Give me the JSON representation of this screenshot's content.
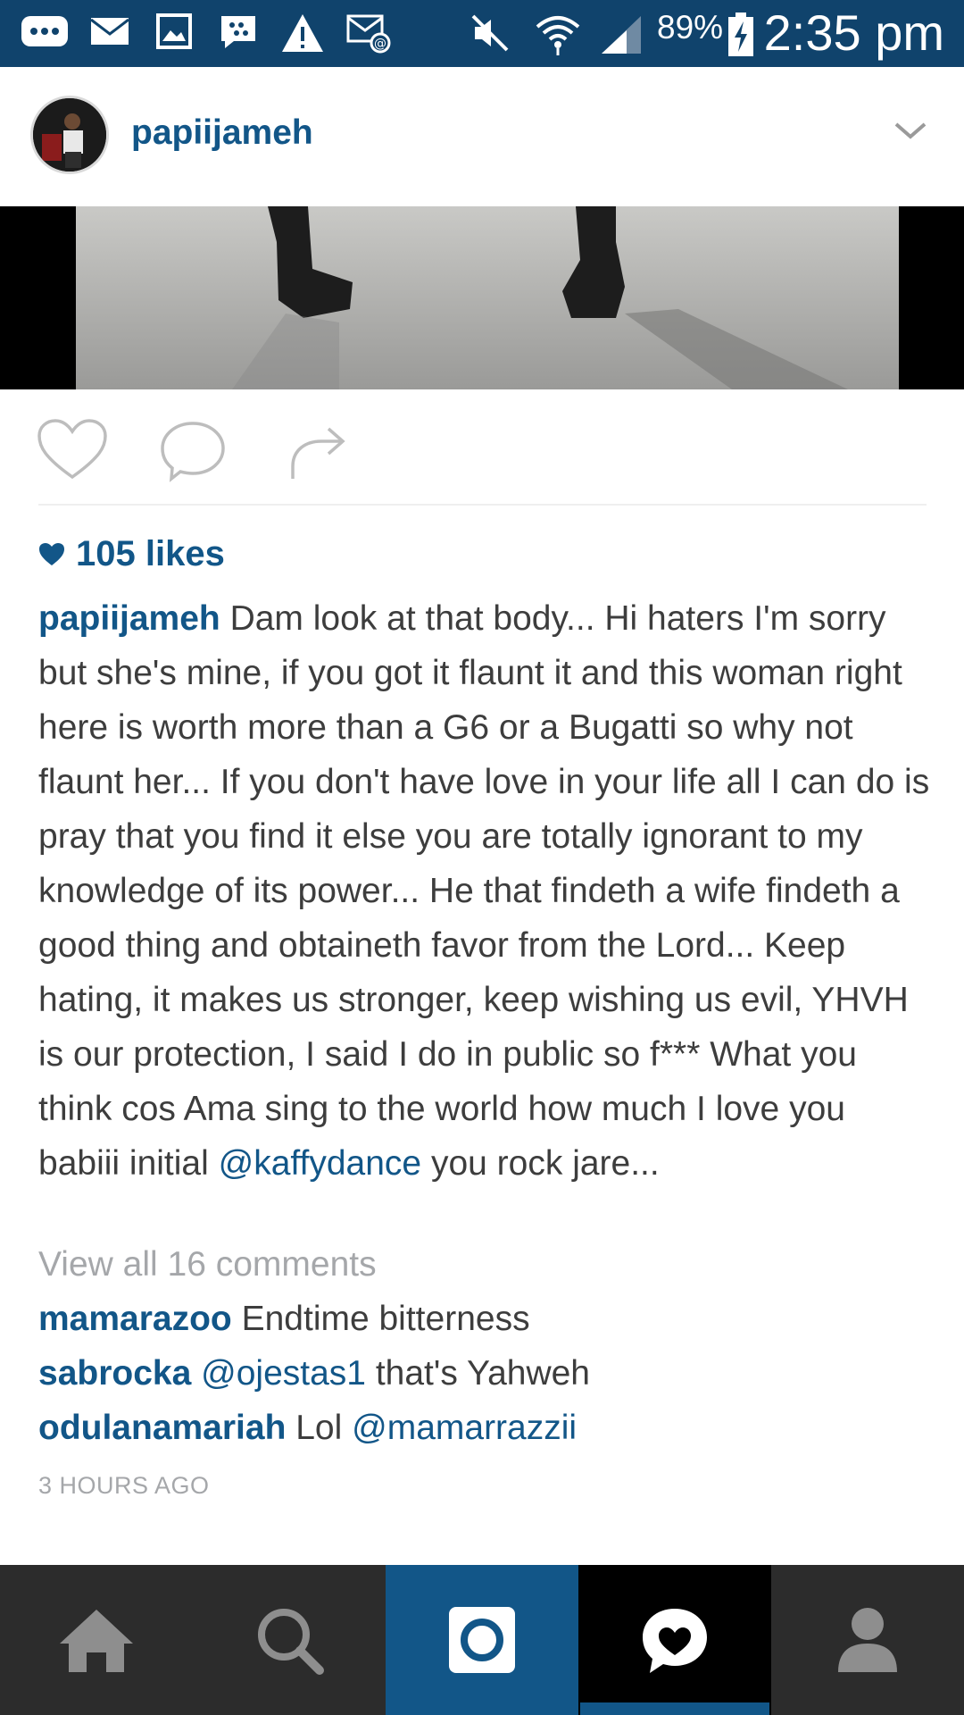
{
  "status_bar": {
    "battery": "89%",
    "time": "2:35 pm",
    "icons": [
      "messages-icon",
      "mail-icon",
      "gallery-icon",
      "bbm-icon",
      "warning-icon",
      "email-at-icon",
      "mute-icon",
      "wifi-icon",
      "signal-icon",
      "battery-charging-icon"
    ]
  },
  "post": {
    "username": "papiijameh",
    "likes": "105 likes",
    "caption_user": "papiijameh",
    "caption_text": " Dam look at that body... Hi haters I'm sorry but she's mine, if you got it flaunt it and this woman right here is worth more than a G6 or a Bugatti so why not flaunt her... If you don't have love in your life all I can do is pray that you find it else you are totally ignorant to my knowledge of its power... He that findeth a wife findeth a good thing and obtaineth favor from the Lord... Keep hating, it makes us stronger, keep wishing us evil, YHVH is our protection, I said I do in public so f*** What you think cos Ama sing to the world how much I love you babiii initial ",
    "caption_mention": "@kaffydance",
    "caption_end": " you rock jare...",
    "view_all": "View all 16 comments",
    "comments": [
      {
        "user": "mamarazoo",
        "pre": " Endtime bitterness",
        "mention": "",
        "post": ""
      },
      {
        "user": "sabrocka",
        "pre": " ",
        "mention": "@ojestas1",
        "post": " that's Yahweh"
      },
      {
        "user": "odulanamariah",
        "pre": " Lol ",
        "mention": "@mamarrazzii",
        "post": ""
      }
    ],
    "time_ago": "3 HOURS AGO"
  },
  "tabs": [
    "home-icon",
    "search-icon",
    "camera-icon",
    "activity-icon",
    "profile-icon"
  ],
  "colors": {
    "status_bar": "#10436c",
    "accent": "#125688",
    "tab_bar": "#2c2c2c",
    "muted": "#a5a7aa"
  }
}
